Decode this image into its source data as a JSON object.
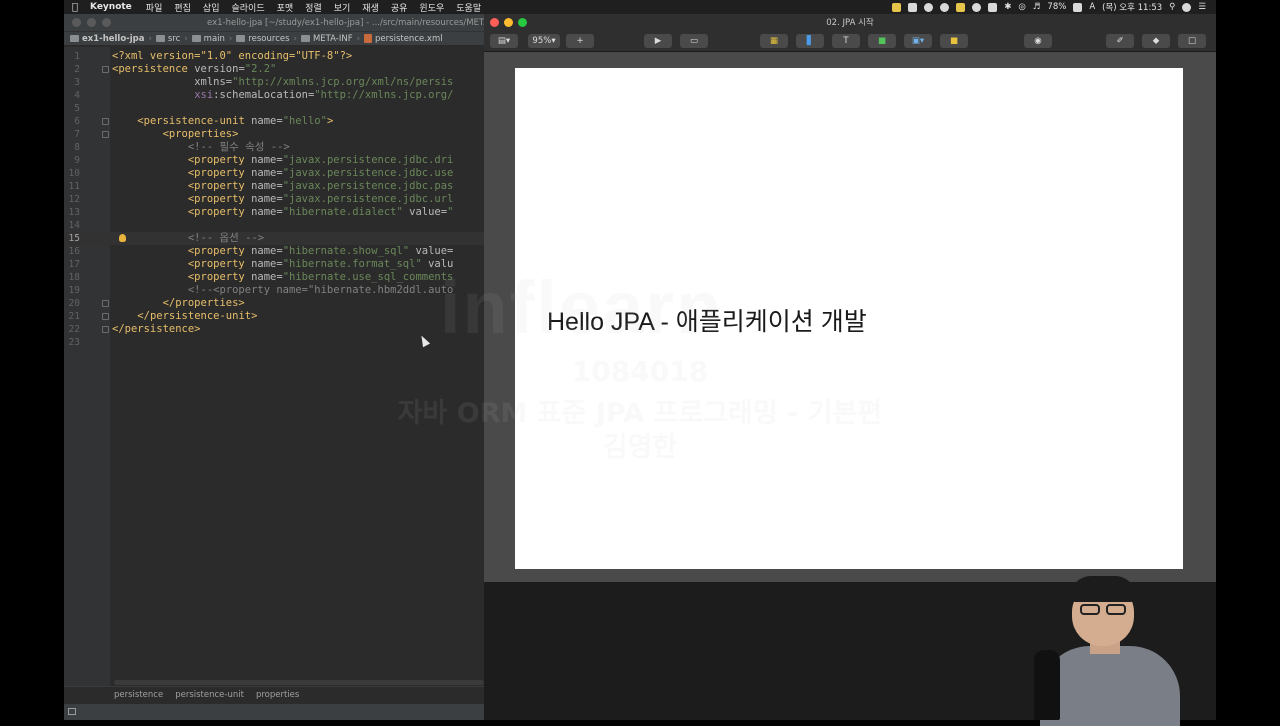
{
  "menubar": {
    "app_name": "Keynote",
    "menus": [
      "파일",
      "편집",
      "삽입",
      "슬라이드",
      "포맷",
      "정렬",
      "보기",
      "재생",
      "공유",
      "윈도우",
      "도움말"
    ],
    "battery": "78%",
    "clock": "(목) 오후 11:53",
    "input_source": "A"
  },
  "ide": {
    "window_title": "ex1-hello-jpa [~/study/ex1-hello-jpa] - .../src/main/resources/META-INF/persistence.xml",
    "breadcrumbs": [
      "ex1-hello-jpa",
      "src",
      "main",
      "resources",
      "META-INF",
      "persistence.xml"
    ],
    "current_line": 15,
    "lines": [
      {
        "n": "1",
        "parts": [
          [
            "t-tag",
            "<?xml version=\"1.0\" encoding=\"UTF-8\"?>"
          ]
        ]
      },
      {
        "n": "2",
        "parts": [
          [
            "t-tag",
            "<persistence "
          ],
          [
            "t-attr",
            "version="
          ],
          [
            "t-val",
            "\"2.2\""
          ]
        ]
      },
      {
        "n": "3",
        "parts": [
          [
            "t-plain",
            "             "
          ],
          [
            "t-attr",
            "xmlns="
          ],
          [
            "t-val",
            "\"http://xmlns.jcp.org/xml/ns/persis"
          ]
        ]
      },
      {
        "n": "4",
        "parts": [
          [
            "t-plain",
            "             "
          ],
          [
            "t-ns",
            "xsi"
          ],
          [
            "t-attr",
            ":schemaLocation="
          ],
          [
            "t-val",
            "\"http://xmlns.jcp.org/"
          ]
        ]
      },
      {
        "n": "5",
        "parts": []
      },
      {
        "n": "6",
        "parts": [
          [
            "t-plain",
            "    "
          ],
          [
            "t-tag",
            "<persistence-unit "
          ],
          [
            "t-attr",
            "name="
          ],
          [
            "t-val",
            "\"hello\""
          ],
          [
            "t-tag",
            ">"
          ]
        ]
      },
      {
        "n": "7",
        "parts": [
          [
            "t-plain",
            "        "
          ],
          [
            "t-tag",
            "<properties>"
          ]
        ]
      },
      {
        "n": "8",
        "parts": [
          [
            "t-plain",
            "            "
          ],
          [
            "t-comment",
            "<!-- 필수 속성 -->"
          ]
        ]
      },
      {
        "n": "9",
        "parts": [
          [
            "t-plain",
            "            "
          ],
          [
            "t-tag",
            "<property "
          ],
          [
            "t-attr",
            "name="
          ],
          [
            "t-val",
            "\"javax.persistence.jdbc.dri"
          ]
        ]
      },
      {
        "n": "10",
        "parts": [
          [
            "t-plain",
            "            "
          ],
          [
            "t-tag",
            "<property "
          ],
          [
            "t-attr",
            "name="
          ],
          [
            "t-val",
            "\"javax.persistence.jdbc.use"
          ]
        ]
      },
      {
        "n": "11",
        "parts": [
          [
            "t-plain",
            "            "
          ],
          [
            "t-tag",
            "<property "
          ],
          [
            "t-attr",
            "name="
          ],
          [
            "t-val",
            "\"javax.persistence.jdbc.pas"
          ]
        ]
      },
      {
        "n": "12",
        "parts": [
          [
            "t-plain",
            "            "
          ],
          [
            "t-tag",
            "<property "
          ],
          [
            "t-attr",
            "name="
          ],
          [
            "t-val",
            "\"javax.persistence.jdbc.url"
          ]
        ]
      },
      {
        "n": "13",
        "parts": [
          [
            "t-plain",
            "            "
          ],
          [
            "t-tag",
            "<property "
          ],
          [
            "t-attr",
            "name="
          ],
          [
            "t-val",
            "\"hibernate.dialect\""
          ],
          [
            "t-attr",
            " value="
          ],
          [
            "t-val",
            "\""
          ]
        ]
      },
      {
        "n": "14",
        "parts": []
      },
      {
        "n": "15",
        "parts": [
          [
            "t-plain",
            "            "
          ],
          [
            "t-comment",
            "<!-- 옵션 -->"
          ]
        ]
      },
      {
        "n": "16",
        "parts": [
          [
            "t-plain",
            "            "
          ],
          [
            "t-tag",
            "<property "
          ],
          [
            "t-attr",
            "name="
          ],
          [
            "t-val",
            "\"hibernate.show_sql\""
          ],
          [
            "t-attr",
            " value="
          ]
        ]
      },
      {
        "n": "17",
        "parts": [
          [
            "t-plain",
            "            "
          ],
          [
            "t-tag",
            "<property "
          ],
          [
            "t-attr",
            "name="
          ],
          [
            "t-val",
            "\"hibernate.format_sql\""
          ],
          [
            "t-attr",
            " valu"
          ]
        ]
      },
      {
        "n": "18",
        "parts": [
          [
            "t-plain",
            "            "
          ],
          [
            "t-tag",
            "<property "
          ],
          [
            "t-attr",
            "name="
          ],
          [
            "t-val",
            "\"hibernate.use_sql_comments"
          ]
        ]
      },
      {
        "n": "19",
        "parts": [
          [
            "t-plain",
            "            "
          ],
          [
            "t-comment",
            "<!--<property name=\"hibernate.hbm2ddl.auto"
          ]
        ]
      },
      {
        "n": "20",
        "parts": [
          [
            "t-plain",
            "        "
          ],
          [
            "t-tag",
            "</properties>"
          ]
        ]
      },
      {
        "n": "21",
        "parts": [
          [
            "t-plain",
            "    "
          ],
          [
            "t-tag",
            "</persistence-unit>"
          ]
        ]
      },
      {
        "n": "22",
        "parts": [
          [
            "t-tag",
            "</persistence>"
          ]
        ]
      },
      {
        "n": "23",
        "parts": []
      }
    ],
    "status_path": [
      "persistence",
      "persistence-unit",
      "properties"
    ]
  },
  "keynote": {
    "doc_title": "02. JPA 시작",
    "zoom": "95%",
    "slide_title": "Hello JPA - 애플리케이션 개발"
  },
  "watermark": {
    "logo": "inflearn",
    "line1": "1084018",
    "line2": "자바 ORM 표준 JPA 프로그래밍 - 기본편",
    "line3": "김영한"
  },
  "colors": {
    "close": "#ff5f57",
    "minimize": "#febc2e",
    "maximize": "#28c840"
  }
}
